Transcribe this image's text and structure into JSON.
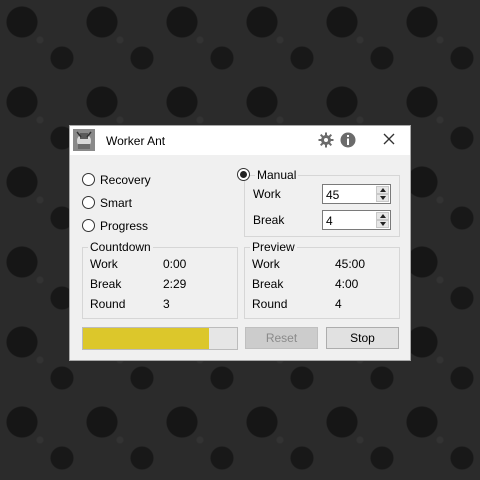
{
  "window": {
    "title": "Worker Ant",
    "icon": "worker-ant-logo"
  },
  "titlebar_buttons": [
    "gear-icon",
    "info-icon",
    "close-icon"
  ],
  "modes": [
    {
      "label": "Recovery",
      "selected": false
    },
    {
      "label": "Smart",
      "selected": false
    },
    {
      "label": "Progress",
      "selected": false
    }
  ],
  "manual": {
    "label": "Manual",
    "selected": true,
    "work_label": "Work",
    "work_value": "45",
    "break_label": "Break",
    "break_value": "4"
  },
  "countdown": {
    "title": "Countdown",
    "rows": [
      {
        "label": "Work",
        "value": "0:00"
      },
      {
        "label": "Break",
        "value": "2:29"
      },
      {
        "label": "Round",
        "value": "3"
      }
    ]
  },
  "preview": {
    "title": "Preview",
    "rows": [
      {
        "label": "Work",
        "value": "45:00"
      },
      {
        "label": "Break",
        "value": "4:00"
      },
      {
        "label": "Round",
        "value": "4"
      }
    ]
  },
  "progress": {
    "percent": 82,
    "color": "#dcc72b"
  },
  "buttons": {
    "reset_label": "Reset",
    "stop_label": "Stop"
  }
}
